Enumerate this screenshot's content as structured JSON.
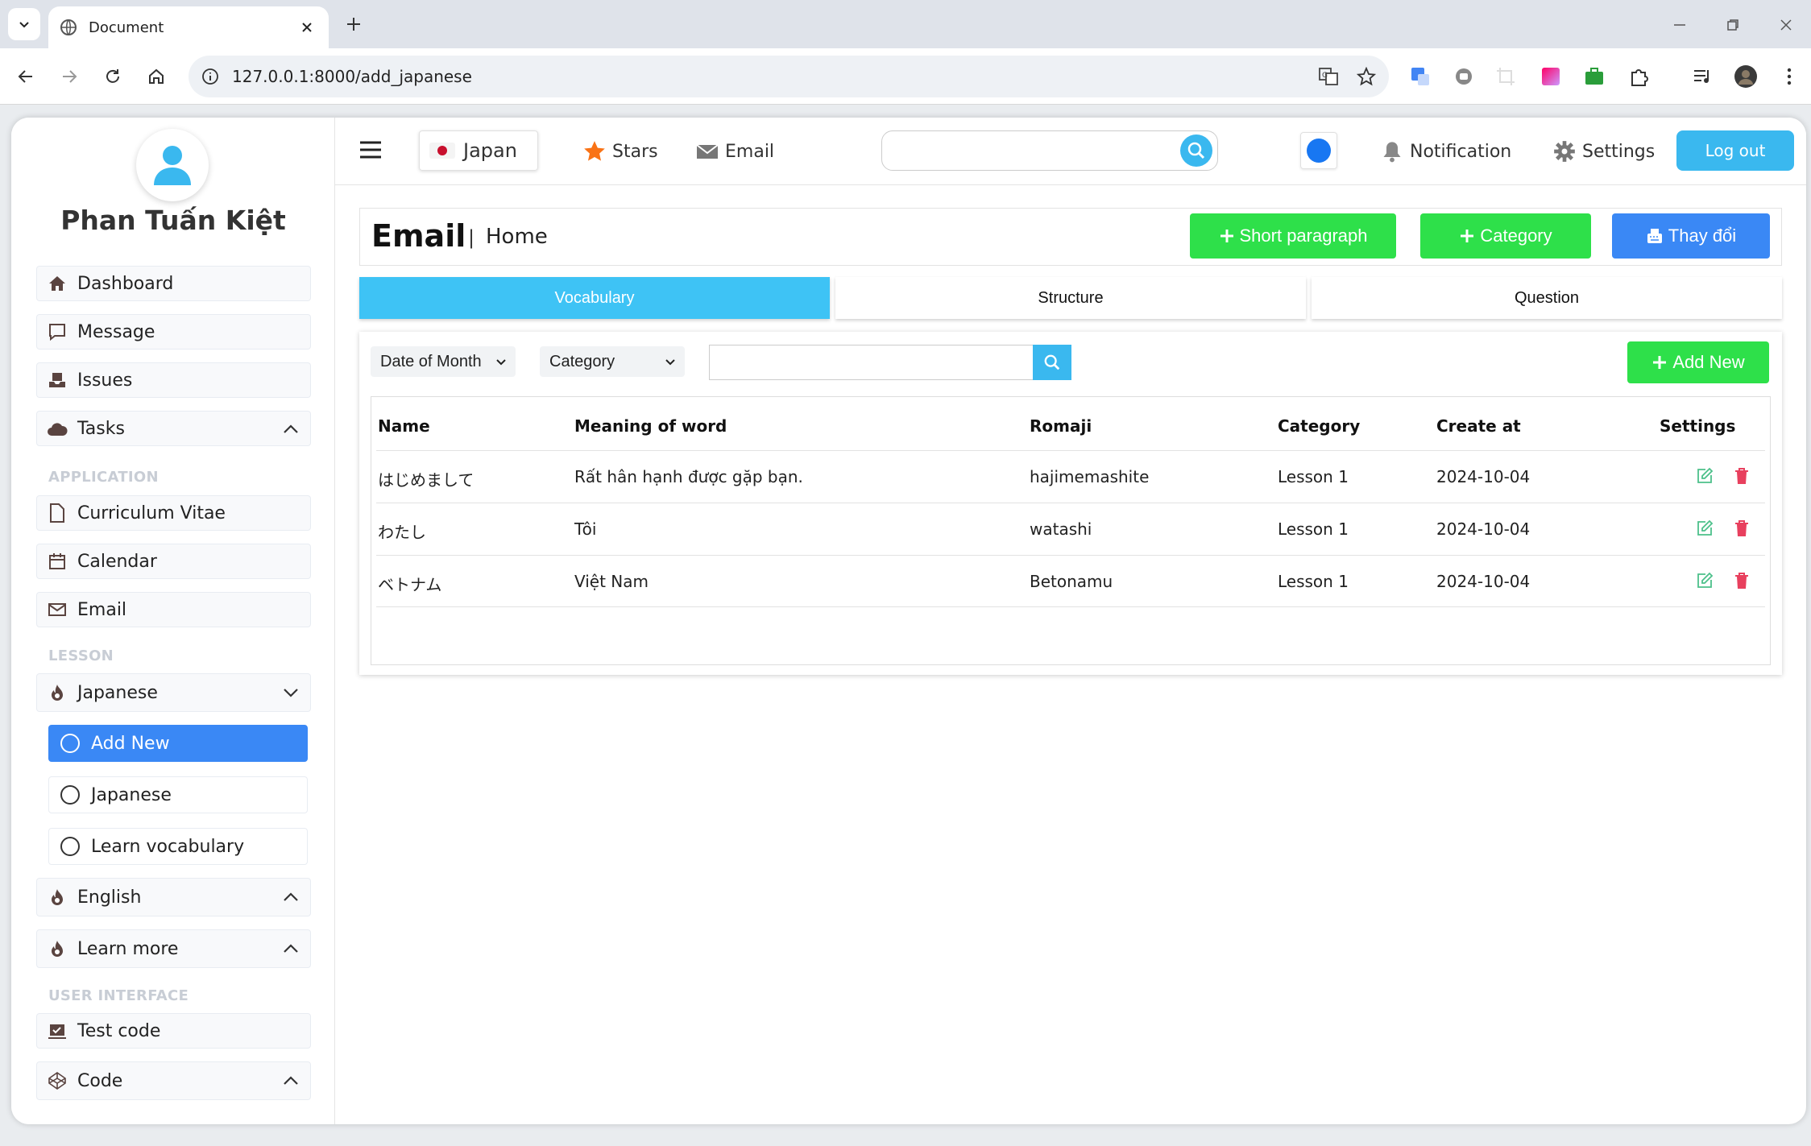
{
  "browser": {
    "tab_title": "Document",
    "url": "127.0.0.1:8000/add_japanese"
  },
  "sidebar": {
    "user_name": "Phan Tuấn Kiệt",
    "items": [
      {
        "label": "Dashboard",
        "icon": "home-icon"
      },
      {
        "label": "Message",
        "icon": "chat-icon"
      },
      {
        "label": "Issues",
        "icon": "inbox-icon"
      },
      {
        "label": "Tasks",
        "icon": "cloud-icon"
      }
    ],
    "section_application": "APPLICATION",
    "app_items": [
      {
        "label": "Curriculum Vitae",
        "icon": "file-icon"
      },
      {
        "label": "Calendar",
        "icon": "calendar-icon"
      },
      {
        "label": "Email",
        "icon": "envelope-icon"
      }
    ],
    "section_lesson": "LESSON",
    "lesson_japanese": "Japanese",
    "lesson_sub": [
      "Add New",
      "Japanese",
      "Learn vocabulary"
    ],
    "lesson_english": "English",
    "lesson_learn_more": "Learn more",
    "section_ui": "USER INTERFACE",
    "ui_test_code": "Test code",
    "ui_code": "Code"
  },
  "header": {
    "language": "Japan",
    "stars": "Stars",
    "email": "Email",
    "search_placeholder": "",
    "notification": "Notification",
    "settings": "Settings",
    "logout": "Log out",
    "colors": {
      "accent": "#3ab8ef",
      "dot": "#1877f2"
    }
  },
  "page": {
    "title": "Email",
    "separator": "|",
    "subtitle": "Home",
    "buttons": {
      "short_paragraph": "Short paragraph",
      "category": "Category",
      "change": "Thay đổi"
    },
    "tabs": [
      "Vocabulary",
      "Structure",
      "Question"
    ],
    "active_tab": "Vocabulary"
  },
  "filters": {
    "date_select": "Date of Month",
    "category_select": "Category",
    "search_value": "",
    "add_new": "Add New"
  },
  "table": {
    "columns": [
      "Name",
      "Meaning of word",
      "Romaji",
      "Category",
      "Create at",
      "Settings"
    ],
    "rows": [
      [
        "はじめまして",
        "Rất hân hạnh được gặp bạn.",
        "hajimemashite",
        "Lesson 1",
        "2024-10-04"
      ],
      [
        "わたし",
        "Tôi",
        "watashi",
        "Lesson 1",
        "2024-10-04"
      ],
      [
        "ベトナム",
        "Việt Nam",
        "Betonamu",
        "Lesson 1",
        "2024-10-04"
      ]
    ]
  }
}
